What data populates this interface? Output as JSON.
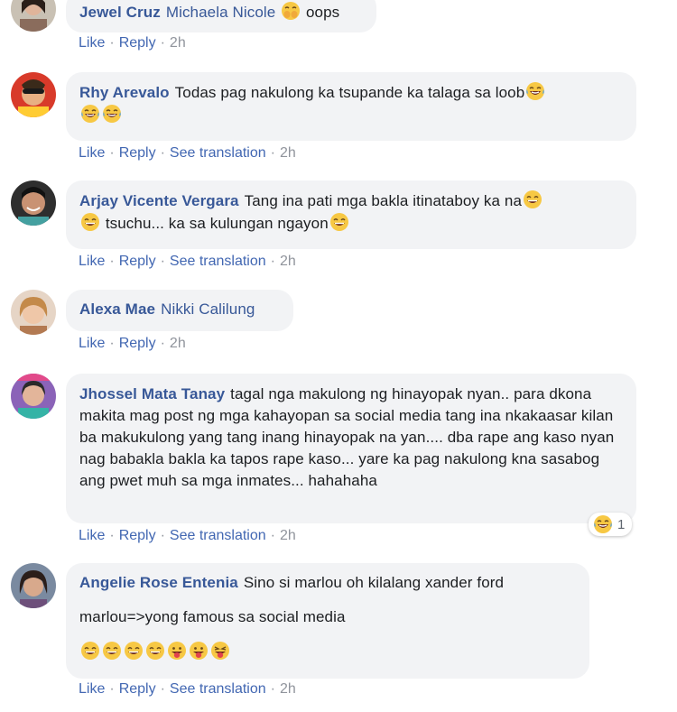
{
  "comments": [
    {
      "author": "Jewel Cruz",
      "mention": "Michaela Nicole",
      "text": "oops",
      "actions": {
        "like": "Like",
        "reply": "Reply",
        "time": "2h"
      }
    },
    {
      "author": "Rhy Arevalo",
      "text": "Todas pag nakulong ka tsupande ka talaga sa loob",
      "actions": {
        "like": "Like",
        "reply": "Reply",
        "translate": "See translation",
        "time": "2h"
      }
    },
    {
      "author": "Arjay Vicente Vergara",
      "text_1": "Tang ina pati mga bakla itinataboy ka na",
      "text_2": "tsuchu... ka sa kulungan ngayon",
      "actions": {
        "like": "Like",
        "reply": "Reply",
        "translate": "See translation",
        "time": "2h"
      }
    },
    {
      "author": "Alexa Mae",
      "mention": "Nikki Calilung",
      "actions": {
        "like": "Like",
        "reply": "Reply",
        "time": "2h"
      }
    },
    {
      "author": "Jhossel Mata Tanay",
      "text": "tagal nga makulong ng hinayopak nyan.. para dkona makita mag post ng mga kahayopan sa social media tang ina nkakaasar kilan ba makukulong yang tang inang hinayopak na yan.... dba rape ang kaso nyan nag babakla bakla ka tapos rape kaso... yare ka pag nakulong kna sasabog ang pwet muh sa mga inmates... hahahaha",
      "reaction_count": "1",
      "actions": {
        "like": "Like",
        "reply": "Reply",
        "translate": "See translation",
        "time": "2h"
      }
    },
    {
      "author": "Angelie Rose Entenia",
      "text": "Sino si marlou oh kilalang xander ford",
      "text_2": "marlou=>yong famous sa social media",
      "actions": {
        "like": "Like",
        "reply": "Reply",
        "translate": "See translation",
        "time": "2h"
      }
    }
  ]
}
